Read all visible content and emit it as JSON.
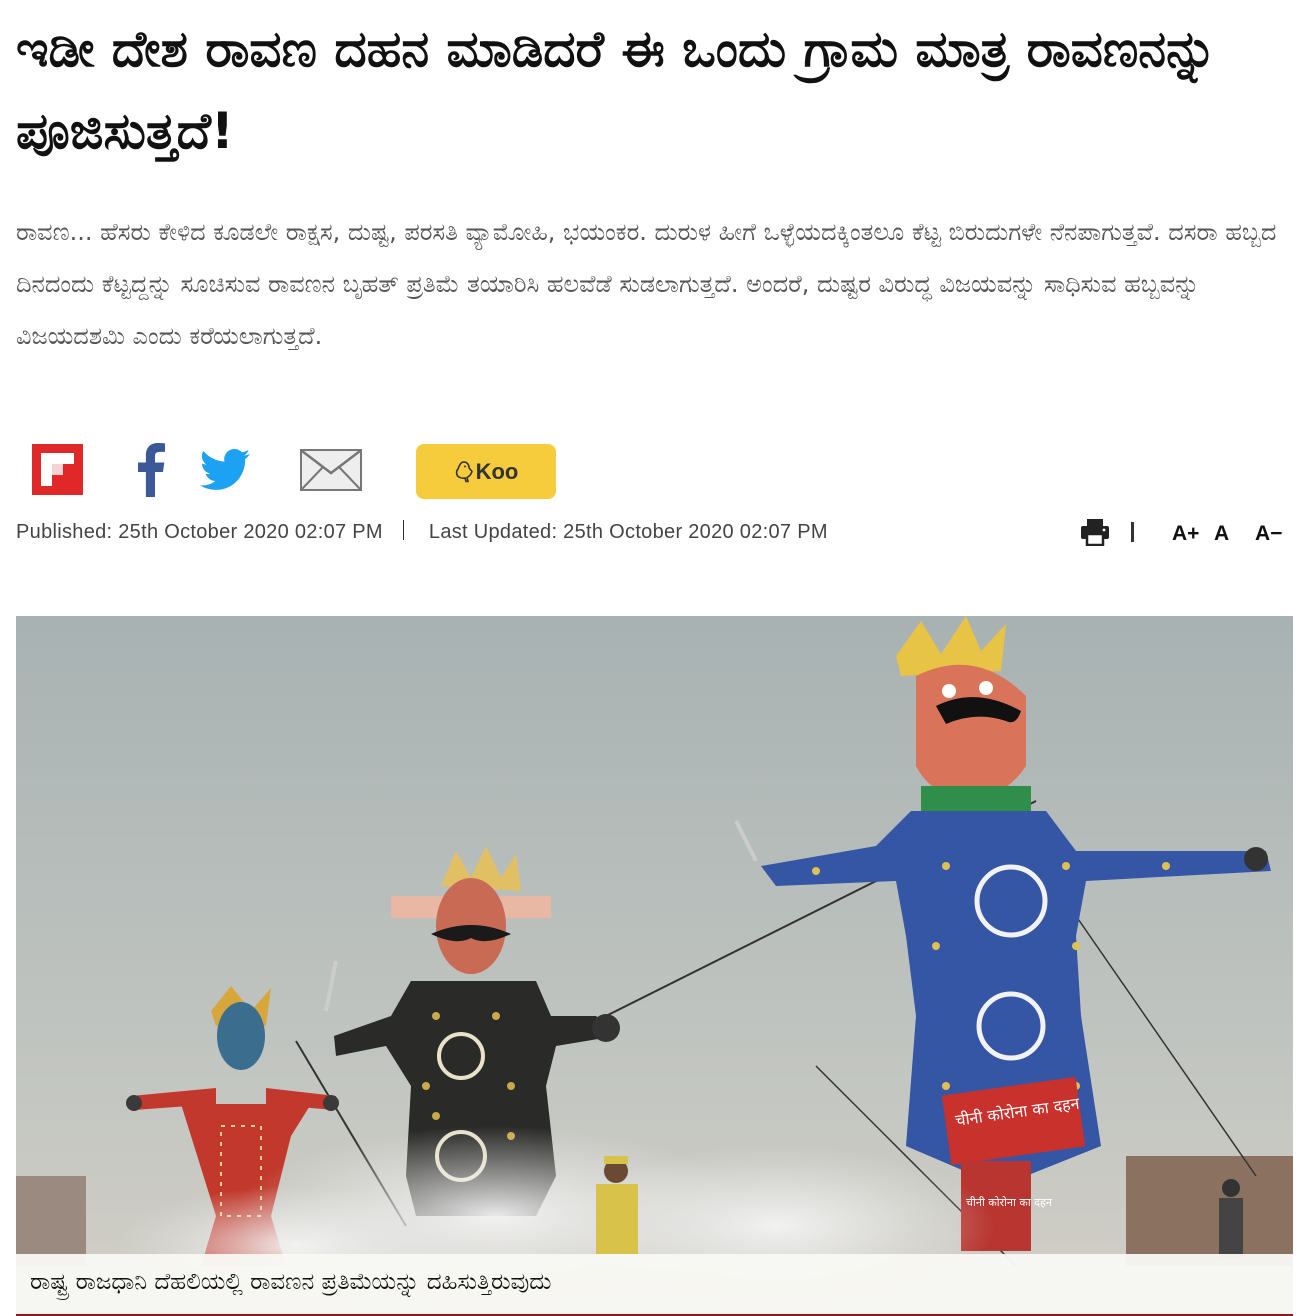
{
  "article": {
    "headline": "ಇಡೀ ದೇಶ ರಾವಣ ದಹನ ಮಾಡಿದರೆ ಈ ಒಂದು ಗ್ರಾಮ ಮಾತ್ರ ರಾವಣನನ್ನು ಪೂಜಿಸುತ್ತದೆ!",
    "summary": "ರಾವಣ... ಹೆಸರು ಕೇಳಿದ ಕೂಡಲೇ ರಾಕ್ಷಸ, ದುಷ್ಟ, ಪರಸತಿ ವ್ಯಾಮೋಹಿ, ಭಯಂಕರ. ದುರುಳ ಹೀಗೆ ಒಳ್ಳೆಯದಕ್ಕಿಂತಲೂ ಕೆಟ್ಟ ಬಿರುದುಗಳೇ ನೆನಪಾಗುತ್ತವೆ. ದಸರಾ ಹಬ್ಬದ ದಿನದಂದು ಕೆಟ್ಟದ್ದನ್ನು ಸೂಚಿಸುವ ರಾವಣನ ಬೃಹತ್ ಪ್ರತಿಮೆ ತಯಾರಿಸಿ ಹಲವೆಡೆ ಸುಡಲಾಗುತ್ತದೆ. ಅಂದರೆ, ದುಷ್ಟರ ವಿರುದ್ಧ ವಿಜಯವನ್ನು ಸಾಧಿಸುವ ಹಬ್ಬವನ್ನು ವಿಜಯದಶಮಿ ಎಂದು ಕರೆಯಲಾಗುತ್ತದೆ.",
    "published": "Published: 25th October 2020 02:07 PM",
    "last_updated": "Last Updated: 25th October 2020 02:07 PM",
    "caption": "ರಾಷ್ಟ್ರ ರಾಜಧಾನಿ ದೆಹಲಿಯಲ್ಲಿ ರಾವಣನ ಪ್ರತಿಮೆಯನ್ನು ದಹಿಸುತ್ತಿರುವುದು"
  },
  "share": {
    "icons": [
      "flipboard-icon",
      "facebook-icon",
      "twitter-icon",
      "email-icon"
    ],
    "koo_label": "Koo"
  },
  "tools": {
    "print_icon": "print-icon",
    "font_increase": "A+",
    "font_normal": "A",
    "font_decrease": "A−"
  },
  "photo": {
    "banner_text": "चीनी कोरोना का दहन",
    "banner_text_small": "चीनी कोरोना का दहन"
  },
  "colors": {
    "headline": "#111111",
    "summary": "#555555",
    "flipboard": "#e12828",
    "facebook": "#3b5998",
    "twitter": "#1da1f2",
    "mail": "#777777",
    "koo": "#f6cc3d",
    "caption_rule": "#8b1a1a"
  }
}
